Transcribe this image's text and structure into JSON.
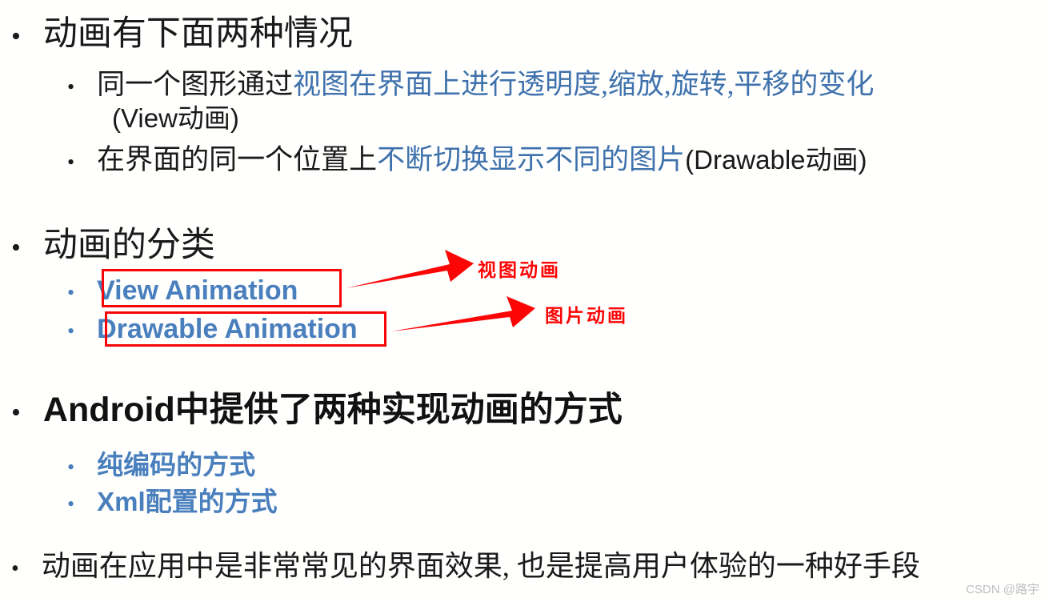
{
  "slide": {
    "watermark": "CSDN @路宇",
    "colors": {
      "accent_blue": "#4a7fbd",
      "text_blue": "#3f72ac",
      "annotation_red": "#fb0505",
      "body_black": "#1a1a1a",
      "background": "#ffffff"
    }
  },
  "bullets": {
    "bullet_glyph": "•",
    "section1": {
      "title": "动画有下面两种情况",
      "item1_black_prefix": "同一个图形通过",
      "item1_blue": "视图在界面上进行透明度,缩放,旋转,平移的变化",
      "item1_wrap": "(View动画)",
      "item2_black_prefix": "在界面的同一个位置上",
      "item2_blue": "不断切换显示不同的图片",
      "item2_black_suffix": "(Drawable动画)"
    },
    "section2": {
      "title": "动画的分类",
      "item1": "View Animation",
      "item2": "Drawable Animation"
    },
    "section3": {
      "title_bold": "Android",
      "title_rest": "中提供了两种实现动画的方式",
      "item1": "纯编码的方式",
      "item2_bold": "Xml",
      "item2_rest": "配置的方式"
    },
    "section4": {
      "title": "动画在应用中是非常常见的界面效果, 也是提高用户体验的一种好手段"
    }
  },
  "annotations": {
    "note1": "视图动画",
    "note2": "图片动画"
  }
}
